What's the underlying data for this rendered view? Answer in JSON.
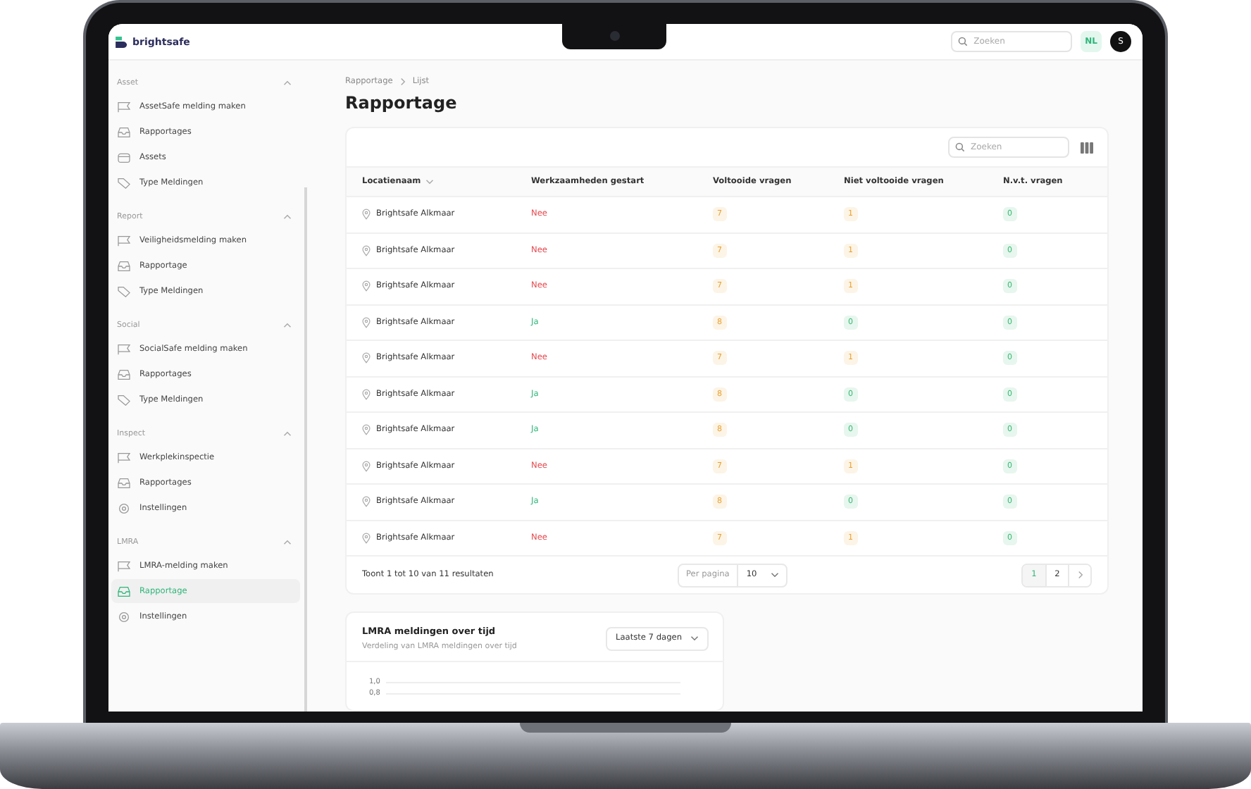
{
  "app": {
    "brand": "brightsafe"
  },
  "topbar": {
    "search": {
      "placeholder": "Zoeken"
    },
    "language": "NL",
    "avatar": "S"
  },
  "sidebar": {
    "groups": [
      {
        "title": "Asset",
        "expanded": true,
        "items": [
          {
            "label": "AssetSafe melding maken",
            "kind": "create",
            "selected": false
          },
          {
            "label": "Rapportages",
            "kind": "reports",
            "selected": false
          },
          {
            "label": "Assets",
            "kind": "list",
            "selected": false
          },
          {
            "label": "Type Meldingen",
            "kind": "types",
            "selected": false
          }
        ]
      },
      {
        "title": "Report",
        "expanded": true,
        "items": [
          {
            "label": "Veiligheidsmelding maken",
            "kind": "create",
            "selected": false
          },
          {
            "label": "Rapportage",
            "kind": "reports",
            "selected": false
          },
          {
            "label": "Type Meldingen",
            "kind": "types",
            "selected": false
          }
        ]
      },
      {
        "title": "Social",
        "expanded": true,
        "items": [
          {
            "label": "SocialSafe melding maken",
            "kind": "create",
            "selected": false
          },
          {
            "label": "Rapportages",
            "kind": "reports",
            "selected": false
          },
          {
            "label": "Type Meldingen",
            "kind": "types",
            "selected": false
          }
        ]
      },
      {
        "title": "Inspect",
        "expanded": true,
        "items": [
          {
            "label": "Werkplekinspectie",
            "kind": "create",
            "selected": false
          },
          {
            "label": "Rapportages",
            "kind": "reports",
            "selected": false
          },
          {
            "label": "Instellingen",
            "kind": "settings",
            "selected": false
          }
        ]
      },
      {
        "title": "LMRA",
        "expanded": true,
        "items": [
          {
            "label": "LMRA-melding maken",
            "kind": "create",
            "selected": false
          },
          {
            "label": "Rapportage",
            "kind": "reports",
            "selected": true
          },
          {
            "label": "Instellingen",
            "kind": "settings",
            "selected": false
          }
        ]
      }
    ]
  },
  "breadcrumb": [
    "Rapportage",
    "Lijst"
  ],
  "page_title": "Rapportage",
  "table": {
    "search": {
      "placeholder": "Zoeken"
    },
    "columns": [
      {
        "label": "Locatienaam",
        "sortable": true
      },
      {
        "label": "Werkzaamheden gestart",
        "sortable": false
      },
      {
        "label": "Voltooide vragen",
        "sortable": false
      },
      {
        "label": "Niet voltooide vragen",
        "sortable": false
      },
      {
        "label": "N.v.t. vragen",
        "sortable": false
      }
    ],
    "rows": [
      {
        "location": "Brightsafe Alkmaar",
        "started": {
          "text": "Nee",
          "value": false
        },
        "counts": [
          {
            "text": "7",
            "color": "#e8a030"
          },
          {
            "text": "1",
            "color": "#e8a030"
          },
          {
            "text": "0",
            "color": "#35b872"
          }
        ]
      },
      {
        "location": "Brightsafe Alkmaar",
        "started": {
          "text": "Nee",
          "value": false
        },
        "counts": [
          {
            "text": "7",
            "color": "#e8a030"
          },
          {
            "text": "1",
            "color": "#e8a030"
          },
          {
            "text": "0",
            "color": "#35b872"
          }
        ]
      },
      {
        "location": "Brightsafe Alkmaar",
        "started": {
          "text": "Nee",
          "value": false
        },
        "counts": [
          {
            "text": "7",
            "color": "#e8a030"
          },
          {
            "text": "1",
            "color": "#e8a030"
          },
          {
            "text": "0",
            "color": "#35b872"
          }
        ]
      },
      {
        "location": "Brightsafe Alkmaar",
        "started": {
          "text": "Ja",
          "value": true
        },
        "counts": [
          {
            "text": "8",
            "color": "#e8a030"
          },
          {
            "text": "0",
            "color": "#35b872"
          },
          {
            "text": "0",
            "color": "#35b872"
          }
        ]
      },
      {
        "location": "Brightsafe Alkmaar",
        "started": {
          "text": "Nee",
          "value": false
        },
        "counts": [
          {
            "text": "7",
            "color": "#e8a030"
          },
          {
            "text": "1",
            "color": "#e8a030"
          },
          {
            "text": "0",
            "color": "#35b872"
          }
        ]
      },
      {
        "location": "Brightsafe Alkmaar",
        "started": {
          "text": "Ja",
          "value": true
        },
        "counts": [
          {
            "text": "8",
            "color": "#e8a030"
          },
          {
            "text": "0",
            "color": "#35b872"
          },
          {
            "text": "0",
            "color": "#35b872"
          }
        ]
      },
      {
        "location": "Brightsafe Alkmaar",
        "started": {
          "text": "Ja",
          "value": true
        },
        "counts": [
          {
            "text": "8",
            "color": "#e8a030"
          },
          {
            "text": "0",
            "color": "#35b872"
          },
          {
            "text": "0",
            "color": "#35b872"
          }
        ]
      },
      {
        "location": "Brightsafe Alkmaar",
        "started": {
          "text": "Nee",
          "value": false
        },
        "counts": [
          {
            "text": "7",
            "color": "#e8a030"
          },
          {
            "text": "1",
            "color": "#e8a030"
          },
          {
            "text": "0",
            "color": "#35b872"
          }
        ]
      },
      {
        "location": "Brightsafe Alkmaar",
        "started": {
          "text": "Ja",
          "value": true
        },
        "counts": [
          {
            "text": "8",
            "color": "#e8a030"
          },
          {
            "text": "0",
            "color": "#35b872"
          },
          {
            "text": "0",
            "color": "#35b872"
          }
        ]
      },
      {
        "location": "Brightsafe Alkmaar",
        "started": {
          "text": "Nee",
          "value": false
        },
        "counts": [
          {
            "text": "7",
            "color": "#e8a030"
          },
          {
            "text": "1",
            "color": "#e8a030"
          },
          {
            "text": "0",
            "color": "#35b872"
          }
        ]
      }
    ],
    "summary": "Toont 1 tot 10 van 11 resultaten",
    "per_page": {
      "label": "Per pagina",
      "value": "10"
    },
    "pages": [
      {
        "label": "1",
        "selected": true
      },
      {
        "label": "2",
        "selected": false
      }
    ]
  },
  "chart_card": {
    "title": "LMRA meldingen over tijd",
    "subtitle": "Verdeling van LMRA meldingen over tijd",
    "range": "Laatste 7 dagen",
    "y_tick_labels": [
      "1,0",
      "0,8"
    ]
  }
}
